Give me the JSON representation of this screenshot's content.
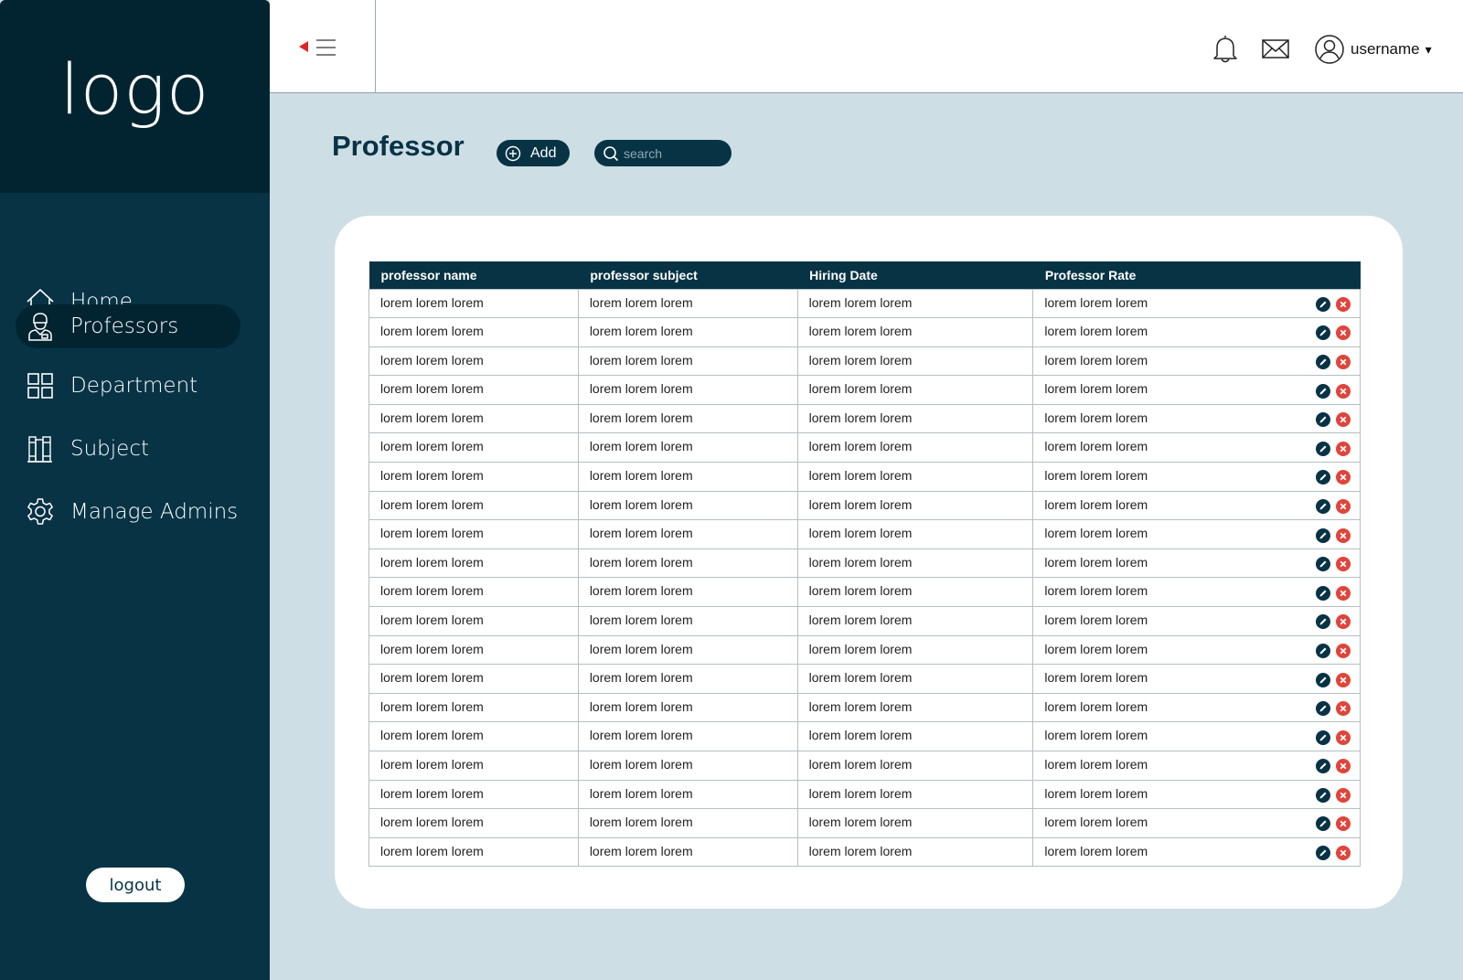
{
  "sidebar": {
    "logo": "logo",
    "items": [
      {
        "label": "Home",
        "icon": "home-icon",
        "active": false
      },
      {
        "label": "Professors",
        "icon": "professor-icon",
        "active": true
      },
      {
        "label": "Department",
        "icon": "grid-icon",
        "active": false
      },
      {
        "label": "Subject",
        "icon": "books-icon",
        "active": false
      },
      {
        "label": "Manage Admins",
        "icon": "gear-icon",
        "active": false
      }
    ],
    "logout_label": "logout"
  },
  "topbar": {
    "username": "username",
    "caret": "▾"
  },
  "page": {
    "title": "Professor",
    "add_label": "Add",
    "search_placeholder": "search"
  },
  "table": {
    "columns": [
      "professor name",
      "professor subject",
      "Hiring Date",
      "Professor Rate"
    ],
    "rows": [
      [
        "lorem lorem lorem",
        "lorem lorem lorem",
        "lorem lorem lorem",
        "lorem lorem lorem"
      ],
      [
        "lorem lorem lorem",
        "lorem lorem lorem",
        "lorem lorem lorem",
        "lorem lorem lorem"
      ],
      [
        "lorem lorem lorem",
        "lorem lorem lorem",
        "lorem lorem lorem",
        "lorem lorem lorem"
      ],
      [
        "lorem lorem lorem",
        "lorem lorem lorem",
        "lorem lorem lorem",
        "lorem lorem lorem"
      ],
      [
        "lorem lorem lorem",
        "lorem lorem lorem",
        "lorem lorem lorem",
        "lorem lorem lorem"
      ],
      [
        "lorem lorem lorem",
        "lorem lorem lorem",
        "lorem lorem lorem",
        "lorem lorem lorem"
      ],
      [
        "lorem lorem lorem",
        "lorem lorem lorem",
        "lorem lorem lorem",
        "lorem lorem lorem"
      ],
      [
        "lorem lorem lorem",
        "lorem lorem lorem",
        "lorem lorem lorem",
        "lorem lorem lorem"
      ],
      [
        "lorem lorem lorem",
        "lorem lorem lorem",
        "lorem lorem lorem",
        "lorem lorem lorem"
      ],
      [
        "lorem lorem lorem",
        "lorem lorem lorem",
        "lorem lorem lorem",
        "lorem lorem lorem"
      ],
      [
        "lorem lorem lorem",
        "lorem lorem lorem",
        "lorem lorem lorem",
        "lorem lorem lorem"
      ],
      [
        "lorem lorem lorem",
        "lorem lorem lorem",
        "lorem lorem lorem",
        "lorem lorem lorem"
      ],
      [
        "lorem lorem lorem",
        "lorem lorem lorem",
        "lorem lorem lorem",
        "lorem lorem lorem"
      ],
      [
        "lorem lorem lorem",
        "lorem lorem lorem",
        "lorem lorem lorem",
        "lorem lorem lorem"
      ],
      [
        "lorem lorem lorem",
        "lorem lorem lorem",
        "lorem lorem lorem",
        "lorem lorem lorem"
      ],
      [
        "lorem lorem lorem",
        "lorem lorem lorem",
        "lorem lorem lorem",
        "lorem lorem lorem"
      ],
      [
        "lorem lorem lorem",
        "lorem lorem lorem",
        "lorem lorem lorem",
        "lorem lorem lorem"
      ],
      [
        "lorem lorem lorem",
        "lorem lorem lorem",
        "lorem lorem lorem",
        "lorem lorem lorem"
      ],
      [
        "lorem lorem lorem",
        "lorem lorem lorem",
        "lorem lorem lorem",
        "lorem lorem lorem"
      ],
      [
        "lorem lorem lorem",
        "lorem lorem lorem",
        "lorem lorem lorem",
        "lorem lorem lorem"
      ]
    ],
    "row_actions": [
      "edit-icon",
      "delete-icon"
    ]
  },
  "colors": {
    "sidebar": "#073345",
    "logo_bg": "#022431",
    "page_bg": "#cddee5",
    "delete": "#e0443a",
    "toggle_arrow": "#e02424"
  }
}
